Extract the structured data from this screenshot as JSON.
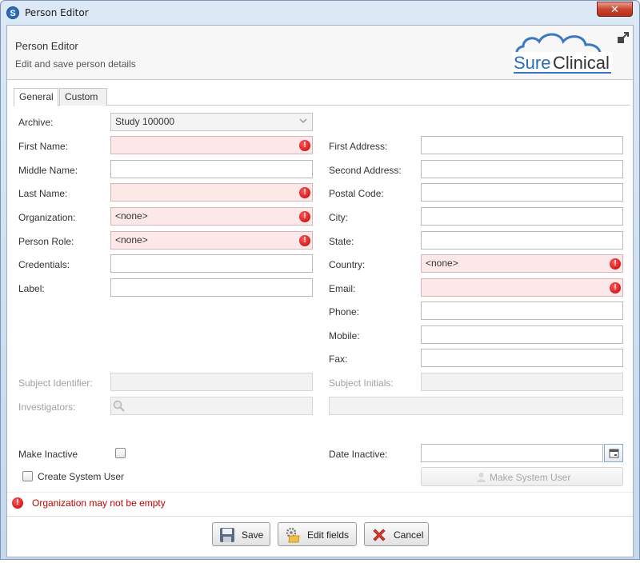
{
  "window": {
    "title": "Person Editor",
    "close_label": "✕"
  },
  "header": {
    "title": "Person Editor",
    "subtitle": "Edit and save person details",
    "logo_text_sure": "Sure",
    "logo_text_clinical": "Clinical"
  },
  "tabs": [
    {
      "label": "General"
    },
    {
      "label": "Custom"
    }
  ],
  "left": {
    "archive": {
      "label": "Archive:",
      "value": "Study 100000"
    },
    "first_name": {
      "label": "First Name:",
      "value": ""
    },
    "middle_name": {
      "label": "Middle Name:",
      "value": ""
    },
    "last_name": {
      "label": "Last Name:",
      "value": ""
    },
    "organization": {
      "label": "Organization:",
      "value": "<none>"
    },
    "person_role": {
      "label": "Person Role:",
      "value": "<none>"
    },
    "credentials": {
      "label": "Credentials:",
      "value": ""
    },
    "label_field": {
      "label": "Label:",
      "value": ""
    },
    "subject_identifier": {
      "label": "Subject Identifier:",
      "value": ""
    },
    "investigators": {
      "label": "Investigators:",
      "value": ""
    }
  },
  "right": {
    "first_address": {
      "label": "First Address:",
      "value": ""
    },
    "second_address": {
      "label": "Second Address:",
      "value": ""
    },
    "postal_code": {
      "label": "Postal Code:",
      "value": ""
    },
    "city": {
      "label": "City:",
      "value": ""
    },
    "state": {
      "label": "State:",
      "value": ""
    },
    "country": {
      "label": "Country:",
      "value": "<none>"
    },
    "email": {
      "label": "Email:",
      "value": ""
    },
    "phone": {
      "label": "Phone:",
      "value": ""
    },
    "mobile": {
      "label": "Mobile:",
      "value": ""
    },
    "fax": {
      "label": "Fax:",
      "value": ""
    },
    "subject_initials": {
      "label": "Subject Initials:",
      "value": ""
    }
  },
  "options": {
    "make_inactive": {
      "label": "Make Inactive",
      "checked": false
    },
    "date_inactive": {
      "label": "Date Inactive:",
      "value": ""
    },
    "create_system_user": {
      "label": "Create System User",
      "checked": false
    },
    "make_system_user": {
      "label": "Make System User"
    }
  },
  "validation": {
    "message": "Organization may not be empty"
  },
  "buttons": {
    "save": "Save",
    "edit_fields": "Edit fields",
    "cancel": "Cancel"
  },
  "colors": {
    "error_bg": "#fce8e8",
    "error_icon": "#c40000",
    "logo_blue": "#2a6db6"
  }
}
